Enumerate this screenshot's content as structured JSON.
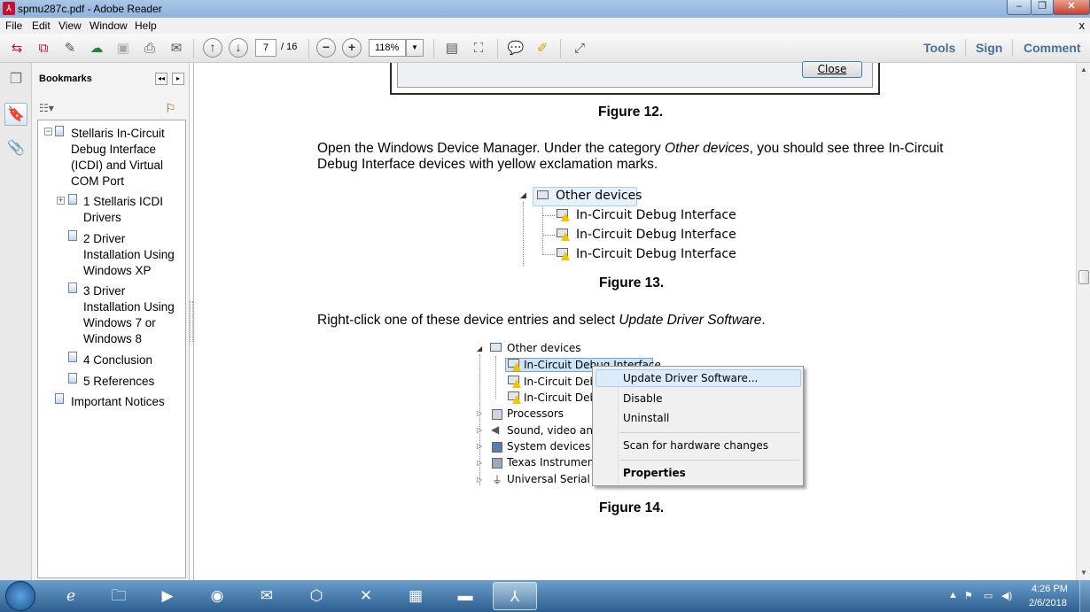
{
  "window": {
    "title": "spmu287c.pdf - Adobe Reader",
    "app_icon": "adobe-reader-icon",
    "minimize": "–",
    "maximize": "❐",
    "close": "✕"
  },
  "menu": {
    "items": [
      "File",
      "Edit",
      "View",
      "Window",
      "Help"
    ],
    "close_x": "x"
  },
  "toolbar": {
    "page_current": "7",
    "page_total": "/ 16",
    "zoom": "118%",
    "zoom_caret": "▼",
    "minus": "−",
    "plus": "+",
    "links": [
      "Tools",
      "Sign",
      "Comment"
    ]
  },
  "bookmarks": {
    "title": "Bookmarks",
    "collapse": "◂◂",
    "expand": "▸",
    "options": "☷▾",
    "tree": [
      {
        "lines": [
          "Stellaris In-Circuit",
          "Debug Interface",
          "(ICDI) and Virtual",
          "COM Port"
        ],
        "expander": "−"
      },
      {
        "lines": [
          "1  Stellaris ICDI",
          "Drivers"
        ],
        "expander": "+"
      },
      {
        "lines": [
          "2  Driver",
          "Installation Using",
          "Windows XP"
        ]
      },
      {
        "lines": [
          "3  Driver",
          "Installation Using",
          "Windows 7 or",
          "Windows 8"
        ]
      },
      {
        "lines": [
          "4  Conclusion"
        ]
      },
      {
        "lines": [
          "5  References"
        ]
      },
      {
        "lines": [
          "Important Notices"
        ]
      }
    ]
  },
  "document": {
    "close_button": "Close",
    "fig12": "Figure 12.",
    "para1_pre": "Open the Windows Device Manager. Under the category ",
    "para1_em": "Other devices",
    "para1_post": ", you should see three In-Circuit",
    "para1_line2": "Debug Interface devices with yellow exclamation marks.",
    "fig13_tree": {
      "category": "Other devices",
      "items": [
        "In-Circuit Debug Interface",
        "In-Circuit Debug Interface",
        "In-Circuit Debug Interface"
      ]
    },
    "fig13": "Figure 13.",
    "para2_pre": "Right-click one of these device entries and select ",
    "para2_em": "Update Driver Software",
    "para2_post": ".",
    "fig14_tree": {
      "category": "Other devices",
      "items": [
        "In-Circuit Debug Interface",
        "In-Circuit Debu",
        "In-Circuit Debu"
      ],
      "other_categories": [
        "Processors",
        "Sound, video and",
        "System devices",
        "Texas Instrument",
        "Universal Serial Bu"
      ]
    },
    "context_menu": [
      "Update Driver Software...",
      "Disable",
      "Uninstall",
      "Scan for hardware changes",
      "Properties"
    ],
    "fig14": "Figure 14."
  },
  "taskbar": {
    "apps": [
      "internet-explorer-icon",
      "file-explorer-icon",
      "media-player-icon",
      "firefox-icon",
      "outlook-icon",
      "package-icon",
      "excel-icon",
      "control-panel-icon",
      "toolbox-icon",
      "adobe-reader-icon"
    ],
    "tray": {
      "chevron": "▲",
      "time": "4:26 PM",
      "date": "2/6/2018"
    }
  }
}
